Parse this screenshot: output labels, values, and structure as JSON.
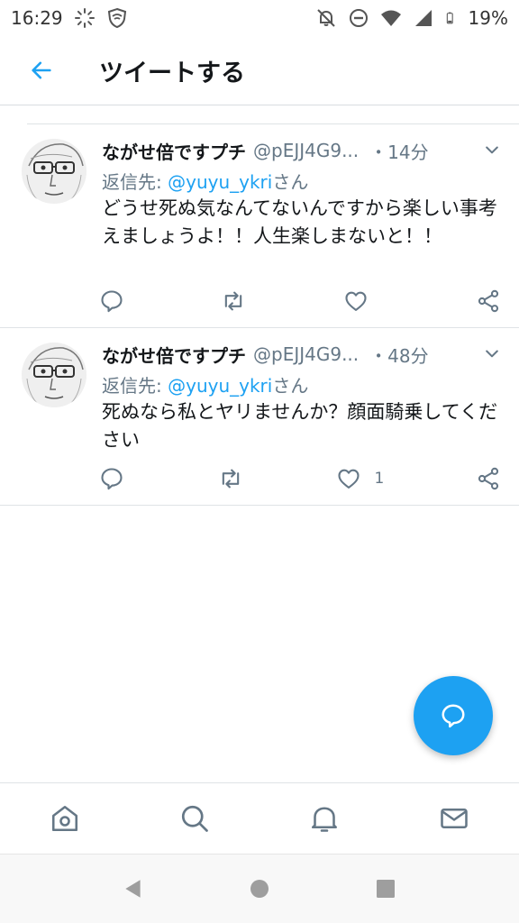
{
  "status_bar": {
    "time": "16:29",
    "battery": "19%"
  },
  "header": {
    "title": "ツイートする"
  },
  "tweets": [
    {
      "author_name": "ながせ倍ですプチ",
      "author_handle": "@pEJJ4G9...",
      "time": "・14分",
      "reply_label": "返信先: ",
      "reply_mention": "@yuyu_ykri",
      "reply_suffix": "さん",
      "text": "どうせ死ぬ気なんてないんですから楽しい事考えましょうよ！！人生楽しまないと！！",
      "like_count": ""
    },
    {
      "author_name": "ながせ倍ですプチ",
      "author_handle": "@pEJJ4G9...",
      "time": "・48分",
      "reply_label": "返信先: ",
      "reply_mention": "@yuyu_ykri",
      "reply_suffix": "さん",
      "text": "死ぬなら私とヤリませんか？顔面騎乗してください",
      "like_count": "1"
    }
  ],
  "colors": {
    "accent": "#1da1f2",
    "text": "#14171a",
    "secondary": "#657786"
  },
  "icons": {
    "back": "arrow-left-icon",
    "more": "chevron-down-icon",
    "reply": "reply-icon",
    "retweet": "retweet-icon",
    "like": "heart-icon",
    "share": "share-icon",
    "fab": "compose-reply-icon",
    "home": "home-icon",
    "search": "search-icon",
    "notifications": "bell-icon",
    "messages": "mail-icon"
  }
}
